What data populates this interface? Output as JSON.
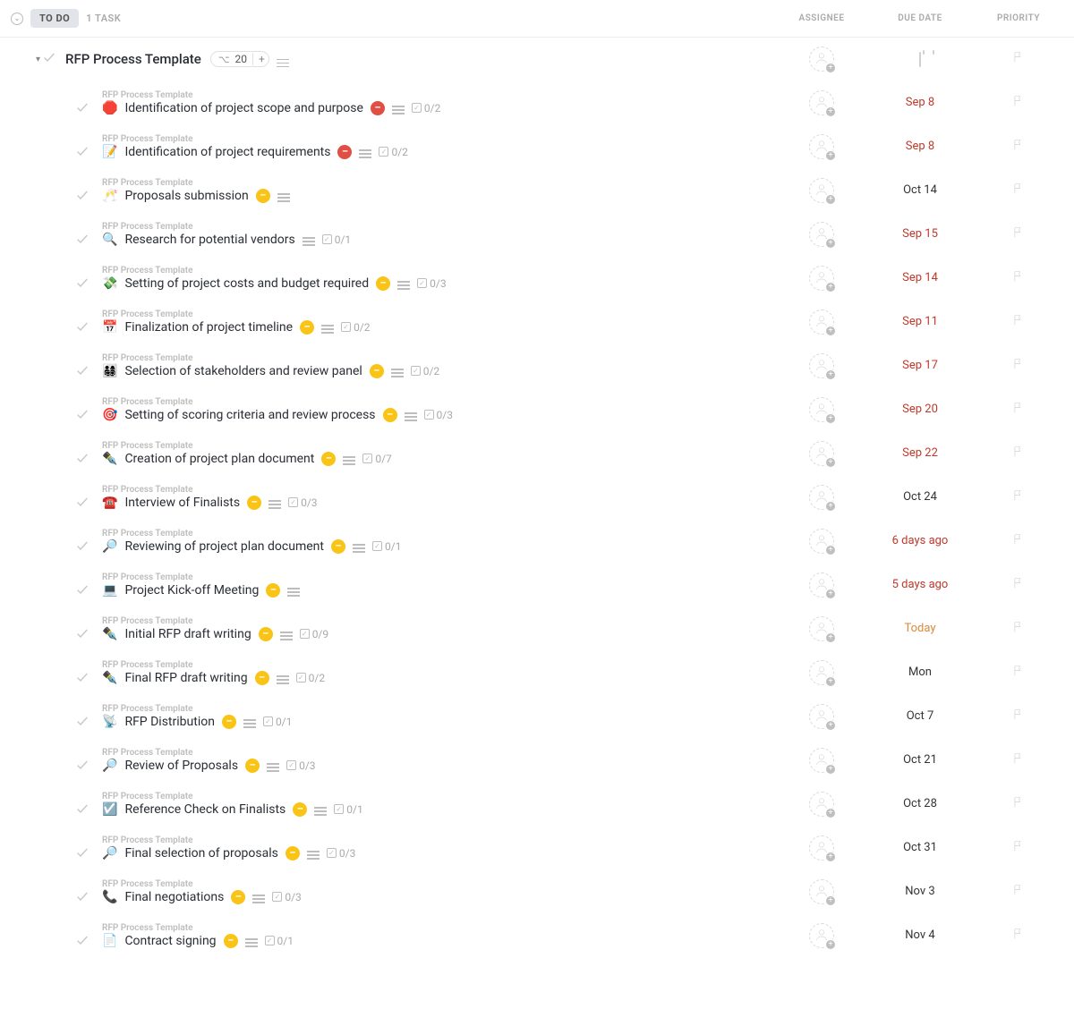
{
  "header": {
    "status_label": "TO DO",
    "task_count_label": "1 TASK",
    "columns": {
      "assignee": "ASSIGNEE",
      "due_date": "DUE DATE",
      "priority": "PRIORITY"
    }
  },
  "group": {
    "title": "RFP Process Template",
    "subtask_count": "20",
    "plus_label": "+"
  },
  "tasks": [
    {
      "crumb": "RFP Process Template",
      "emoji": "🛑",
      "title": "Identification of project scope and purpose",
      "badge": "red",
      "has_desc": true,
      "checklist": "0/2",
      "due": "Sep 8",
      "due_style": "overdue"
    },
    {
      "crumb": "RFP Process Template",
      "emoji": "📝",
      "title": "Identification of project requirements",
      "badge": "red",
      "has_desc": true,
      "checklist": "0/2",
      "due": "Sep 8",
      "due_style": "overdue"
    },
    {
      "crumb": "RFP Process Template",
      "emoji": "🥂",
      "title": "Proposals submission",
      "badge": "yellow",
      "has_desc": true,
      "checklist": "",
      "due": "Oct 14",
      "due_style": "normal"
    },
    {
      "crumb": "RFP Process Template",
      "emoji": "🔍",
      "title": "Research for potential vendors",
      "badge": "",
      "has_desc": true,
      "checklist": "0/1",
      "due": "Sep 15",
      "due_style": "overdue"
    },
    {
      "crumb": "RFP Process Template",
      "emoji": "💸",
      "title": "Setting of project costs and budget required",
      "badge": "yellow",
      "has_desc": true,
      "checklist": "0/3",
      "due": "Sep 14",
      "due_style": "overdue"
    },
    {
      "crumb": "RFP Process Template",
      "emoji": "📅",
      "title": "Finalization of project timeline",
      "badge": "yellow",
      "has_desc": true,
      "checklist": "0/2",
      "due": "Sep 11",
      "due_style": "overdue"
    },
    {
      "crumb": "RFP Process Template",
      "emoji": "👨‍👩‍👧‍👦",
      "title": "Selection of stakeholders and review panel",
      "badge": "yellow",
      "has_desc": true,
      "checklist": "0/2",
      "due": "Sep 17",
      "due_style": "overdue"
    },
    {
      "crumb": "RFP Process Template",
      "emoji": "🎯",
      "title": "Setting of scoring criteria and review process",
      "badge": "yellow",
      "has_desc": true,
      "checklist": "0/3",
      "due": "Sep 20",
      "due_style": "overdue"
    },
    {
      "crumb": "RFP Process Template",
      "emoji": "✒️",
      "title": "Creation of project plan document",
      "badge": "yellow",
      "has_desc": true,
      "checklist": "0/7",
      "due": "Sep 22",
      "due_style": "overdue"
    },
    {
      "crumb": "RFP Process Template",
      "emoji": "☎️",
      "title": "Interview of Finalists",
      "badge": "yellow",
      "has_desc": true,
      "checklist": "0/3",
      "due": "Oct 24",
      "due_style": "normal"
    },
    {
      "crumb": "RFP Process Template",
      "emoji": "🔎",
      "title": "Reviewing of project plan document",
      "badge": "yellow",
      "has_desc": true,
      "checklist": "0/1",
      "due": "6 days ago",
      "due_style": "overdue"
    },
    {
      "crumb": "RFP Process Template",
      "emoji": "💻",
      "title": "Project Kick-off Meeting",
      "badge": "yellow",
      "has_desc": true,
      "checklist": "",
      "due": "5 days ago",
      "due_style": "overdue"
    },
    {
      "crumb": "RFP Process Template",
      "emoji": "✒️",
      "title": "Initial RFP draft writing",
      "badge": "yellow",
      "has_desc": true,
      "checklist": "0/9",
      "due": "Today",
      "due_style": "today"
    },
    {
      "crumb": "RFP Process Template",
      "emoji": "✒️",
      "title": "Final RFP draft writing",
      "badge": "yellow",
      "has_desc": true,
      "checklist": "0/2",
      "due": "Mon",
      "due_style": "normal"
    },
    {
      "crumb": "RFP Process Template",
      "emoji": "📡",
      "title": "RFP Distribution",
      "badge": "yellow",
      "has_desc": true,
      "checklist": "0/1",
      "due": "Oct 7",
      "due_style": "normal"
    },
    {
      "crumb": "RFP Process Template",
      "emoji": "🔎",
      "title": "Review of Proposals",
      "badge": "yellow",
      "has_desc": true,
      "checklist": "0/3",
      "due": "Oct 21",
      "due_style": "normal"
    },
    {
      "crumb": "RFP Process Template",
      "emoji": "☑️",
      "title": "Reference Check on Finalists",
      "badge": "yellow",
      "has_desc": true,
      "checklist": "0/1",
      "due": "Oct 28",
      "due_style": "normal"
    },
    {
      "crumb": "RFP Process Template",
      "emoji": "🔎",
      "title": "Final selection of proposals",
      "badge": "yellow",
      "has_desc": true,
      "checklist": "0/3",
      "due": "Oct 31",
      "due_style": "normal"
    },
    {
      "crumb": "RFP Process Template",
      "emoji": "📞",
      "title": "Final negotiations",
      "badge": "yellow",
      "has_desc": true,
      "checklist": "0/3",
      "due": "Nov 3",
      "due_style": "normal"
    },
    {
      "crumb": "RFP Process Template",
      "emoji": "📄",
      "title": "Contract signing",
      "badge": "yellow",
      "has_desc": true,
      "checklist": "0/1",
      "due": "Nov 4",
      "due_style": "normal"
    }
  ]
}
